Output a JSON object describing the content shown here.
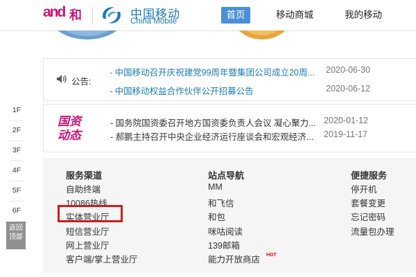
{
  "header": {
    "brand_and": "and",
    "brand_he": "和",
    "cm_name_cn": "中国移动",
    "cm_name_en": "China Mobile",
    "nav": {
      "home": "首页",
      "mall": "移动商城",
      "mine": "我的移动",
      "more": ""
    }
  },
  "floor_nav": {
    "items": [
      "1F",
      "2F",
      "3F",
      "4F",
      "5F",
      "6F"
    ],
    "back_top_1": "返回",
    "back_top_2": "顶部"
  },
  "notice": {
    "label": "公告:",
    "items": [
      {
        "title": "- 中国移动召开庆祝建党99周年暨集团公司成立20周...",
        "date": "2020-06-30"
      },
      {
        "title": "- 中国移动权益合作伙伴公开招募公告",
        "date": "2020-06-12"
      }
    ]
  },
  "news": {
    "label_line1": "国资",
    "label_line2": "动态",
    "items": [
      {
        "title": "- 国务院国资委召开地方国资委负责人会议 凝心聚力...",
        "date": "2020-01-12"
      },
      {
        "title": "- 郝鹏主持召开中央企业经济运行座谈会和宏观经济...",
        "date": "2019-11-17"
      }
    ]
  },
  "services": {
    "columns": [
      {
        "title": "服务渠道",
        "items": [
          "自助终端",
          "10086热线",
          "实体营业厅",
          "短信营业厅",
          "网上营业厅",
          "客户端/掌上营业厅"
        ]
      },
      {
        "title": "站点导航",
        "items": [
          "MM",
          "和飞信",
          "和包",
          "咪咕阅读",
          "139邮箱",
          "能力开放商店"
        ]
      },
      {
        "title": "便捷服务",
        "items": [
          "停开机",
          "套餐变更",
          "忘记密码",
          "流量包办理"
        ]
      }
    ],
    "hot_badge": "HOT",
    "highlighted_item": "实体营业厅"
  },
  "colors": {
    "accent_blue": "#1c7ab9",
    "brand_magenta": "#c9157b",
    "nav_active": "#4a8fd8",
    "highlight_red": "#cc1d1d"
  }
}
